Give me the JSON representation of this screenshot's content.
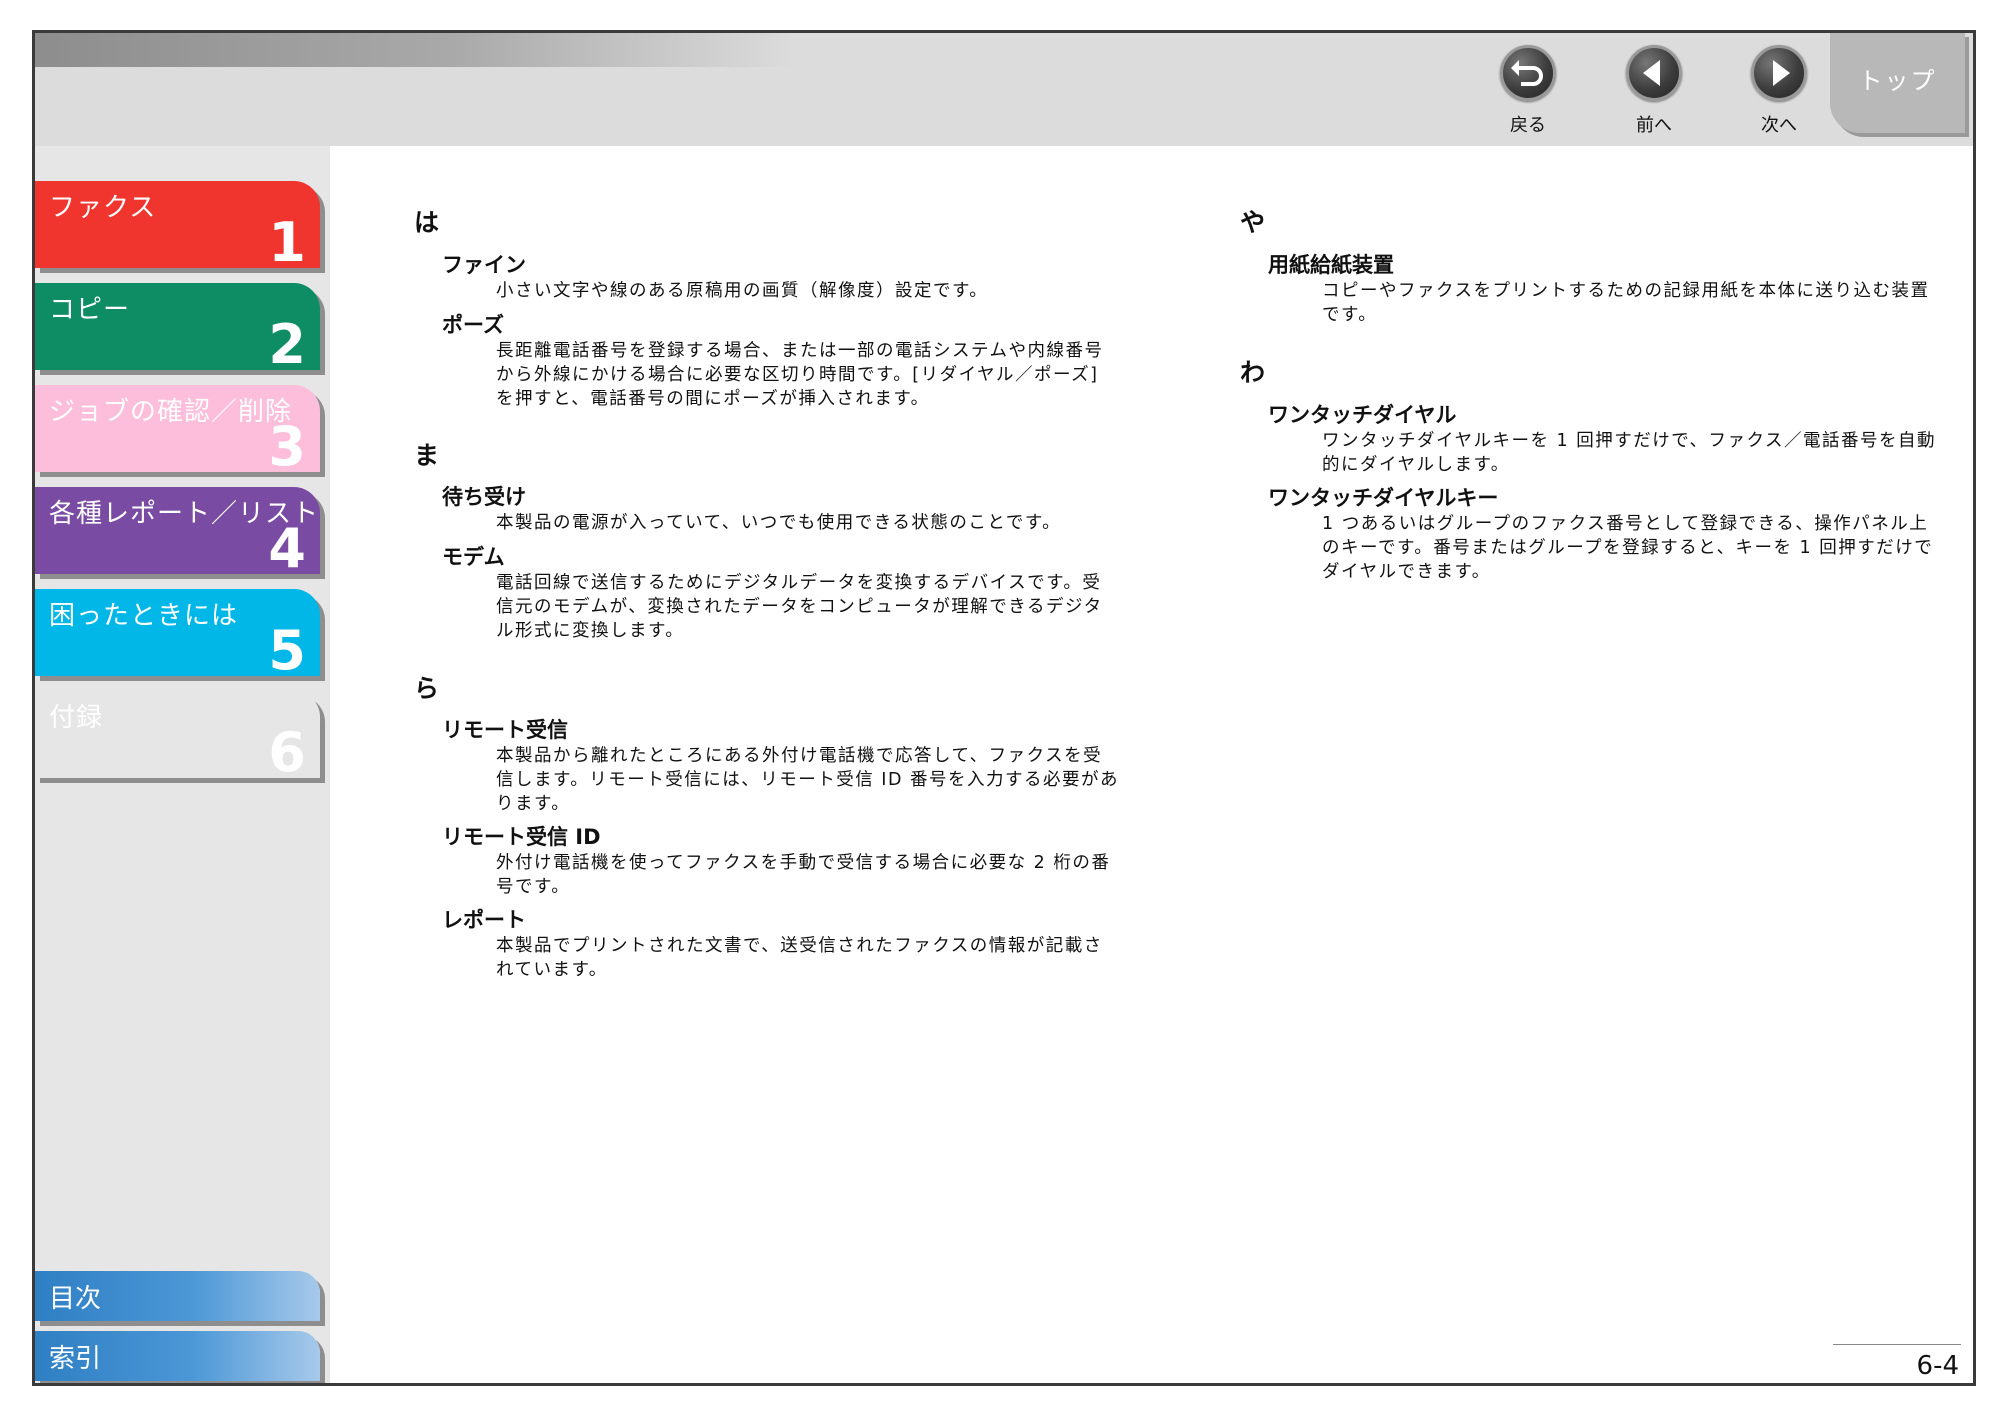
{
  "nav": {
    "back_label": "戻る",
    "prev_label": "前へ",
    "next_label": "次へ",
    "top_label": "トップ"
  },
  "sidebar": {
    "chapters": [
      {
        "title": "ファクス",
        "num": "1",
        "color": "#f0352f"
      },
      {
        "title": "コピー",
        "num": "2",
        "color": "#0e8c63"
      },
      {
        "title": "ジョブの確認／削除",
        "num": "3",
        "color": "#fdbedb"
      },
      {
        "title": "各種レポート／リスト",
        "num": "4",
        "color": "#7a4ba3"
      },
      {
        "title": "困ったときには",
        "num": "5",
        "color": "#00b7e8"
      },
      {
        "title": "付録",
        "num": "6",
        "color": "#e6e6e6"
      }
    ],
    "toc_label": "目次",
    "index_label": "索引"
  },
  "content": {
    "ha": {
      "heading": "は",
      "terms": [
        {
          "term": "ファイン",
          "lines": [
            "小さい文字や線のある原稿用の画質（解像度）設定です。"
          ]
        },
        {
          "term": "ポーズ",
          "lines": [
            "長距離電話番号を登録する場合、または一部の電話システムや内線番号",
            "から外線にかける場合に必要な区切り時間です。[リダイヤル／ポーズ]",
            "を押すと、電話番号の間にポーズが挿入されます。"
          ]
        }
      ]
    },
    "ma": {
      "heading": "ま",
      "terms": [
        {
          "term": "待ち受け",
          "lines": [
            "本製品の電源が入っていて、いつでも使用できる状態のことです。"
          ]
        },
        {
          "term": "モデム",
          "lines": [
            "電話回線で送信するためにデジタルデータを変換するデバイスです。受",
            "信元のモデムが、変換されたデータをコンピュータが理解できるデジタ",
            "ル形式に変換します。"
          ]
        }
      ]
    },
    "ra": {
      "heading": "ら",
      "terms": [
        {
          "term": "リモート受信",
          "lines": [
            "本製品から離れたところにある外付け電話機で応答して、ファクスを受",
            "信します。リモート受信には、リモート受信 ID 番号を入力する必要があ",
            "ります。"
          ]
        },
        {
          "term": "リモート受信 ID",
          "lines": [
            "外付け電話機を使ってファクスを手動で受信する場合に必要な 2 桁の番",
            "号です。"
          ]
        },
        {
          "term": "レポート",
          "lines": [
            "本製品でプリントされた文書で、送受信されたファクスの情報が記載さ",
            "れています。"
          ]
        }
      ]
    },
    "ya": {
      "heading": "や",
      "terms": [
        {
          "term": "用紙給紙装置",
          "lines": [
            "コピーやファクスをプリントするための記録用紙を本体に送り込む装置",
            "です。"
          ]
        }
      ]
    },
    "wa": {
      "heading": "わ",
      "terms": [
        {
          "term": "ワンタッチダイヤル",
          "lines": [
            "ワンタッチダイヤルキーを 1 回押すだけで、ファクス／電話番号を自動",
            "的にダイヤルします。"
          ]
        },
        {
          "term": "ワンタッチダイヤルキー",
          "lines": [
            "1 つあるいはグループのファクス番号として登録できる、操作パネル上",
            "のキーです。番号またはグループを登録すると、キーを 1 回押すだけで",
            "ダイヤルできます。"
          ]
        }
      ]
    }
  },
  "page_number": "6-4"
}
